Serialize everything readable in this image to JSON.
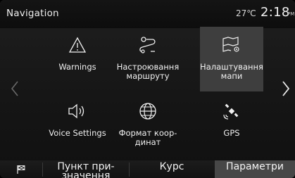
{
  "header": {
    "title": "Navigation",
    "temperature": "27℃",
    "time": "2:18",
    "ampm": "PM"
  },
  "nav_arrows": {
    "left_icon": "chevron-left-icon",
    "right_icon": "chevron-right-icon"
  },
  "tiles": [
    {
      "label": "Warnings",
      "icon": "warning-triangle-icon",
      "selected": false
    },
    {
      "label": "Настроювання\nмаршруту",
      "icon": "route-settings-icon",
      "selected": false
    },
    {
      "label": "Налаштування\nмапи",
      "icon": "map-settings-icon",
      "selected": true
    },
    {
      "label": "Voice Settings",
      "icon": "speaker-icon",
      "selected": false
    },
    {
      "label": "Формат коор-\nдинат",
      "icon": "globe-icon",
      "selected": false
    },
    {
      "label": "GPS",
      "icon": "satellite-icon",
      "selected": false
    }
  ],
  "footer": {
    "flag_icon": "checkered-flag-icon",
    "tabs": [
      {
        "label": "Пункт при-\nзначення",
        "active": false
      },
      {
        "label": "Курс",
        "active": false
      },
      {
        "label": "Параметри",
        "active": true
      }
    ]
  },
  "colors": {
    "selected_tile": "#3e3e3e",
    "active_tab": "#474747",
    "text": "#f0f0f0"
  }
}
